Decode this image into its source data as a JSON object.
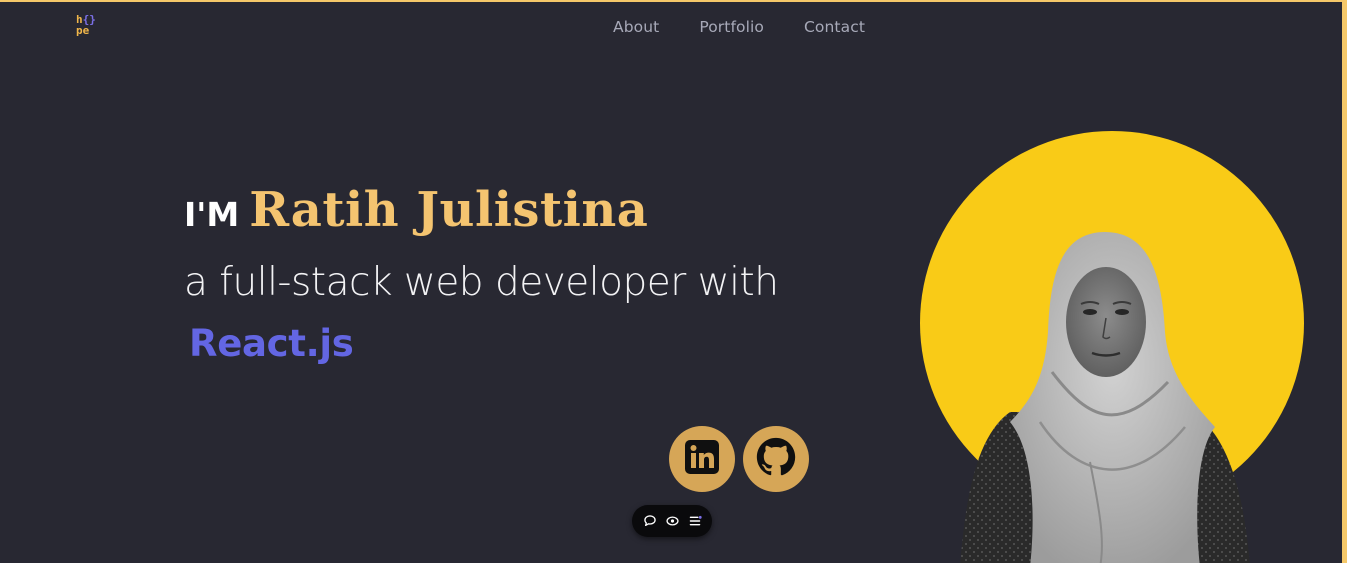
{
  "logo": {
    "line1_a": "h",
    "line1_b": "{}",
    "line2": "pe"
  },
  "nav": {
    "items": [
      {
        "label": "About"
      },
      {
        "label": "Portfolio"
      },
      {
        "label": "Contact"
      }
    ]
  },
  "hero": {
    "prefix": "I'M",
    "name": "Ratih Julistina",
    "subtitle": "a full-stack web developer with",
    "tech": "React.js"
  },
  "social": {
    "linkedin_icon": "linkedin-icon",
    "github_icon": "github-icon"
  },
  "toolbar": {
    "icons": [
      "comment-icon",
      "eye-icon",
      "menu-list-icon"
    ]
  },
  "colors": {
    "background": "#282832",
    "accent_gold": "#f4c470",
    "accent_purple": "#6366e3",
    "circle_yellow": "#f9cb17",
    "social_bg": "#d6a657",
    "border": "#f5c869"
  }
}
